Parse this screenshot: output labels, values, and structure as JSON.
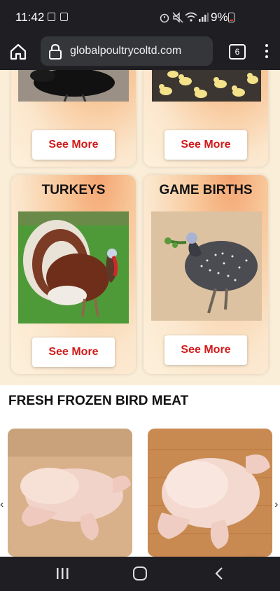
{
  "status_bar": {
    "time": "11:42",
    "battery": "9%"
  },
  "browser": {
    "url": "globalpoultrycoltd.com",
    "tab_count": "6"
  },
  "cards_top": [
    {
      "button": "See More"
    },
    {
      "button": "See More"
    }
  ],
  "cards": [
    {
      "title": "TURKEYS",
      "button": "See More"
    },
    {
      "title": "GAME BIRTHS",
      "button": "See More"
    }
  ],
  "section": {
    "title": "FRESH FROZEN BIRD MEAT"
  },
  "colors": {
    "accent_red": "#d21a1a",
    "whatsapp_green": "#25d366",
    "chat_blue": "#1e88e5"
  }
}
